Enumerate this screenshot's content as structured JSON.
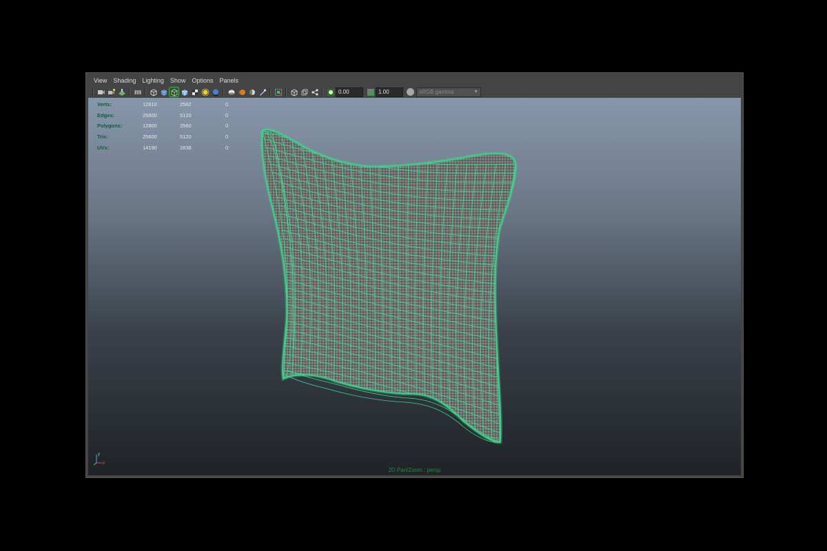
{
  "menus": [
    "View",
    "Shading",
    "Lighting",
    "Show",
    "Options",
    "Panels"
  ],
  "toolbar": {
    "icons": [
      "select-camera-icon",
      "lock-camera-icon",
      "bookmark-icon",
      "grid-icon",
      "wireframe-icon",
      "smooth-shade-icon",
      "wireframe-on-shaded-icon",
      "default-material-icon",
      "textured-icon",
      "use-all-lights-icon",
      "shadows-icon",
      "ambient-occlusion-icon",
      "motion-blur-icon",
      "multisample-icon",
      "depth-of-field-icon",
      "isolate-select-icon",
      "xray-icon",
      "xray-joints-icon",
      "xray-components-icon",
      "exposure-icon",
      "gamma-icon"
    ],
    "exposure_value": "0.00",
    "gamma_value": "1.00",
    "color_management": "sRGB gamma"
  },
  "hud": {
    "rows": [
      {
        "label": "Verts:",
        "values": [
          "12810",
          "2562",
          "0"
        ]
      },
      {
        "label": "Edges:",
        "values": [
          "25600",
          "5120",
          "0"
        ]
      },
      {
        "label": "Polygons:",
        "values": [
          "12800",
          "2560",
          "0"
        ]
      },
      {
        "label": "Tris:",
        "values": [
          "25600",
          "5120",
          "0"
        ]
      },
      {
        "label": "UVs:",
        "values": [
          "14190",
          "2838",
          "0"
        ]
      }
    ]
  },
  "camera_label": "2D Pan/Zoom : persp",
  "axis": {
    "y": "y",
    "x": "x"
  },
  "colors": {
    "wireframe": "#3dd68c",
    "hud_label": "#0f5e34",
    "active_button": "#3ab54a"
  }
}
